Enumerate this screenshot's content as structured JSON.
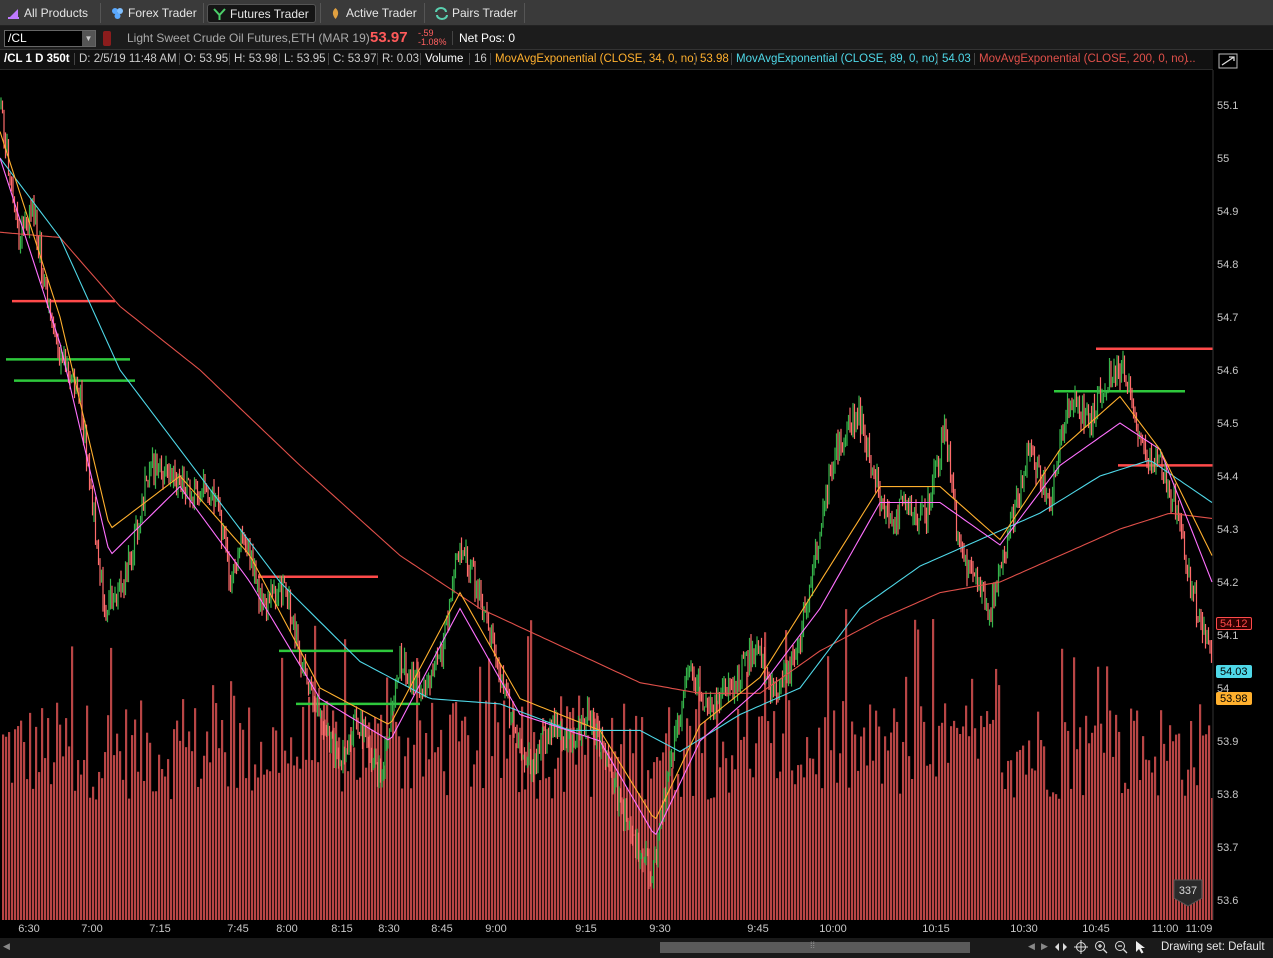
{
  "tabs": [
    {
      "label": "All Products",
      "icon": "all-products-icon",
      "color": "#c07aff"
    },
    {
      "label": "Forex Trader",
      "icon": "forex-icon",
      "color": "#5aa9ff"
    },
    {
      "label": "Futures Trader",
      "icon": "futures-icon",
      "color": "#4ccf6a",
      "active": true
    },
    {
      "label": "Active Trader",
      "icon": "active-trader-icon",
      "color": "#e0a040"
    },
    {
      "label": "Pairs Trader",
      "icon": "pairs-icon",
      "color": "#5ad0b0"
    }
  ],
  "quote": {
    "symbol": "/CL",
    "description": "Light Sweet Crude Oil Futures,ETH (MAR 19)",
    "last": "53.97",
    "change": "-.59",
    "change_pct": "-1.08%",
    "net_pos": "Net Pos: 0"
  },
  "studybar": {
    "title": "/CL 1 D 350t",
    "date": "D: 2/5/19 11:48 AM",
    "open": "O: 53.95",
    "high": "H: 53.98",
    "low": "L: 53.95",
    "close": "C: 53.97",
    "range": "R: 0.03",
    "volume_label": "Volume",
    "volume_value": "16",
    "ema34_label": "MovAvgExponential (CLOSE, 34, 0, no)",
    "ema34_value": "53.98",
    "ema89_label": "MovAvgExponential (CLOSE, 89, 0, no)",
    "ema89_value": "54.03",
    "ema200_label": "MovAvgExponential (CLOSE, 200, 0, no)",
    "ellipsis": "..."
  },
  "colors": {
    "up": "#35b34a",
    "down": "#ff6b6b",
    "volume": "#b84545",
    "ema34": "#ffb02e",
    "ema89": "#4fd8e8",
    "ema200": "#e0504a",
    "ema_pink": "#ff70ff",
    "level_red": "#ff4a4a",
    "level_green": "#2ec83c"
  },
  "chart_data": {
    "type": "candlestick",
    "ylim": [
      53.55,
      55.15
    ],
    "price_ticks": [
      "55.1",
      "55",
      "54.9",
      "54.8",
      "54.7",
      "54.6",
      "54.5",
      "54.4",
      "54.3",
      "54.2",
      "54.1",
      "54",
      "53.9",
      "53.8",
      "53.7",
      "53.6"
    ],
    "time_labels": [
      "6:30",
      "7:00",
      "7:15",
      "7:45",
      "8:00",
      "8:15",
      "8:30",
      "8:45",
      "9:00",
      "9:15",
      "9:30",
      "9:45",
      "10:00",
      "10:15",
      "10:30",
      "10:45",
      "11:00",
      "11:09"
    ],
    "price_path": [
      [
        0,
        55.1
      ],
      [
        20,
        54.85
      ],
      [
        33,
        54.9
      ],
      [
        55,
        54.65
      ],
      [
        80,
        54.55
      ],
      [
        105,
        54.15
      ],
      [
        125,
        54.2
      ],
      [
        150,
        54.42
      ],
      [
        185,
        54.38
      ],
      [
        215,
        54.37
      ],
      [
        230,
        54.2
      ],
      [
        245,
        54.3
      ],
      [
        262,
        54.15
      ],
      [
        285,
        54.2
      ],
      [
        300,
        54.05
      ],
      [
        320,
        53.95
      ],
      [
        340,
        53.85
      ],
      [
        355,
        53.95
      ],
      [
        380,
        53.83
      ],
      [
        400,
        54.05
      ],
      [
        420,
        54.0
      ],
      [
        440,
        54.05
      ],
      [
        460,
        54.28
      ],
      [
        475,
        54.2
      ],
      [
        490,
        54.1
      ],
      [
        510,
        53.95
      ],
      [
        530,
        53.85
      ],
      [
        550,
        53.93
      ],
      [
        570,
        53.9
      ],
      [
        590,
        53.95
      ],
      [
        610,
        53.85
      ],
      [
        630,
        53.72
      ],
      [
        653,
        53.65
      ],
      [
        670,
        53.85
      ],
      [
        690,
        54.05
      ],
      [
        710,
        53.95
      ],
      [
        730,
        54.0
      ],
      [
        755,
        54.08
      ],
      [
        775,
        53.98
      ],
      [
        795,
        54.05
      ],
      [
        815,
        54.25
      ],
      [
        835,
        54.45
      ],
      [
        858,
        54.52
      ],
      [
        875,
        54.4
      ],
      [
        890,
        54.3
      ],
      [
        905,
        54.35
      ],
      [
        925,
        54.32
      ],
      [
        945,
        54.5
      ],
      [
        960,
        54.25
      ],
      [
        978,
        54.2
      ],
      [
        990,
        54.15
      ],
      [
        1010,
        54.3
      ],
      [
        1030,
        54.45
      ],
      [
        1050,
        54.35
      ],
      [
        1070,
        54.55
      ],
      [
        1090,
        54.5
      ],
      [
        1105,
        54.58
      ],
      [
        1125,
        54.6
      ],
      [
        1140,
        54.45
      ],
      [
        1160,
        54.42
      ],
      [
        1175,
        54.35
      ],
      [
        1190,
        54.2
      ],
      [
        1212,
        54.05
      ]
    ],
    "ema34_path": [
      [
        0,
        55.05
      ],
      [
        60,
        54.7
      ],
      [
        110,
        54.3
      ],
      [
        180,
        54.4
      ],
      [
        250,
        54.25
      ],
      [
        320,
        54.0
      ],
      [
        390,
        53.93
      ],
      [
        460,
        54.18
      ],
      [
        520,
        53.98
      ],
      [
        600,
        53.92
      ],
      [
        655,
        53.75
      ],
      [
        700,
        53.93
      ],
      [
        760,
        54.02
      ],
      [
        820,
        54.2
      ],
      [
        880,
        54.38
      ],
      [
        940,
        54.38
      ],
      [
        1000,
        54.28
      ],
      [
        1060,
        54.45
      ],
      [
        1120,
        54.55
      ],
      [
        1160,
        54.45
      ],
      [
        1212,
        54.25
      ]
    ],
    "ema_pink_path": [
      [
        0,
        55.0
      ],
      [
        60,
        54.65
      ],
      [
        110,
        54.25
      ],
      [
        180,
        54.38
      ],
      [
        250,
        54.2
      ],
      [
        320,
        53.98
      ],
      [
        390,
        53.9
      ],
      [
        460,
        54.15
      ],
      [
        520,
        53.95
      ],
      [
        600,
        53.9
      ],
      [
        655,
        53.72
      ],
      [
        700,
        53.9
      ],
      [
        760,
        54.0
      ],
      [
        820,
        54.15
      ],
      [
        880,
        54.35
      ],
      [
        940,
        54.35
      ],
      [
        1000,
        54.27
      ],
      [
        1060,
        54.42
      ],
      [
        1120,
        54.5
      ],
      [
        1160,
        54.45
      ],
      [
        1212,
        54.2
      ]
    ],
    "ema89_path": [
      [
        0,
        55.0
      ],
      [
        60,
        54.85
      ],
      [
        120,
        54.6
      ],
      [
        200,
        54.4
      ],
      [
        280,
        54.2
      ],
      [
        360,
        54.05
      ],
      [
        430,
        53.98
      ],
      [
        500,
        53.97
      ],
      [
        570,
        53.92
      ],
      [
        640,
        53.92
      ],
      [
        680,
        53.88
      ],
      [
        740,
        53.95
      ],
      [
        800,
        54.0
      ],
      [
        860,
        54.15
      ],
      [
        920,
        54.23
      ],
      [
        980,
        54.28
      ],
      [
        1040,
        54.33
      ],
      [
        1100,
        54.4
      ],
      [
        1150,
        54.43
      ],
      [
        1212,
        54.35
      ]
    ],
    "ema200_path": [
      [
        0,
        54.86
      ],
      [
        60,
        54.85
      ],
      [
        120,
        54.72
      ],
      [
        200,
        54.6
      ],
      [
        300,
        54.42
      ],
      [
        400,
        54.25
      ],
      [
        480,
        54.15
      ],
      [
        560,
        54.08
      ],
      [
        640,
        54.01
      ],
      [
        700,
        53.99
      ],
      [
        760,
        53.99
      ],
      [
        820,
        54.07
      ],
      [
        880,
        54.13
      ],
      [
        940,
        54.18
      ],
      [
        1000,
        54.2
      ],
      [
        1060,
        54.25
      ],
      [
        1120,
        54.3
      ],
      [
        1170,
        54.33
      ],
      [
        1212,
        54.32
      ]
    ],
    "levels": [
      {
        "color": "red",
        "y": 54.73,
        "x0": 12,
        "x1": 115
      },
      {
        "color": "green",
        "y": 54.62,
        "x0": 6,
        "x1": 130
      },
      {
        "color": "green",
        "y": 54.58,
        "x0": 14,
        "x1": 135
      },
      {
        "color": "red",
        "y": 54.21,
        "x0": 258,
        "x1": 378
      },
      {
        "color": "green",
        "y": 54.07,
        "x0": 279,
        "x1": 393
      },
      {
        "color": "green",
        "y": 53.97,
        "x0": 296,
        "x1": 420
      },
      {
        "color": "red",
        "y": 54.64,
        "x0": 1096,
        "x1": 1213
      },
      {
        "color": "green",
        "y": 54.56,
        "x0": 1054,
        "x1": 1185
      },
      {
        "color": "red",
        "y": 54.42,
        "x0": 1118,
        "x1": 1213
      }
    ],
    "volume_max_label": "337",
    "badges": [
      {
        "label": "54.12",
        "value": 54.12,
        "color": "#ff4a4a",
        "text": "#ff4a4a",
        "bg": "#300000"
      },
      {
        "label": "54.03",
        "value": 54.03,
        "color": "#4fd8e8",
        "text": "#000",
        "bg": "#4fd8e8"
      },
      {
        "label": "53.98",
        "value": 53.98,
        "color": "#ffb02e",
        "text": "#000",
        "bg": "#ffb02e"
      }
    ]
  },
  "footer": {
    "drawing_set": "Drawing set: Default"
  }
}
